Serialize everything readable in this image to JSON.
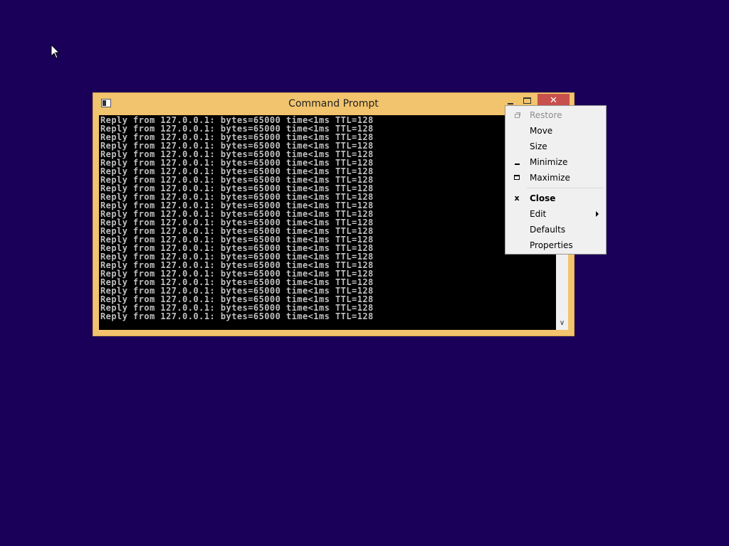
{
  "window": {
    "title": "Command Prompt",
    "close_glyph": "✕"
  },
  "console": {
    "lines": [
      "Reply from 127.0.0.1: bytes=65000 time<1ms TTL=128",
      "Reply from 127.0.0.1: bytes=65000 time<1ms TTL=128",
      "Reply from 127.0.0.1: bytes=65000 time<1ms TTL=128",
      "Reply from 127.0.0.1: bytes=65000 time<1ms TTL=128",
      "Reply from 127.0.0.1: bytes=65000 time<1ms TTL=128",
      "Reply from 127.0.0.1: bytes=65000 time<1ms TTL=128",
      "Reply from 127.0.0.1: bytes=65000 time<1ms TTL=128",
      "Reply from 127.0.0.1: bytes=65000 time<1ms TTL=128",
      "Reply from 127.0.0.1: bytes=65000 time<1ms TTL=128",
      "Reply from 127.0.0.1: bytes=65000 time<1ms TTL=128",
      "Reply from 127.0.0.1: bytes=65000 time<1ms TTL=128",
      "Reply from 127.0.0.1: bytes=65000 time<1ms TTL=128",
      "Reply from 127.0.0.1: bytes=65000 time<1ms TTL=128",
      "Reply from 127.0.0.1: bytes=65000 time<1ms TTL=128",
      "Reply from 127.0.0.1: bytes=65000 time<1ms TTL=128",
      "Reply from 127.0.0.1: bytes=65000 time<1ms TTL=128",
      "Reply from 127.0.0.1: bytes=65000 time<1ms TTL=128",
      "Reply from 127.0.0.1: bytes=65000 time<1ms TTL=128",
      "Reply from 127.0.0.1: bytes=65000 time<1ms TTL=128",
      "Reply from 127.0.0.1: bytes=65000 time<1ms TTL=128",
      "Reply from 127.0.0.1: bytes=65000 time<1ms TTL=128",
      "Reply from 127.0.0.1: bytes=65000 time<1ms TTL=128",
      "Reply from 127.0.0.1: bytes=65000 time<1ms TTL=128",
      "Reply from 127.0.0.1: bytes=65000 time<1ms TTL=128"
    ]
  },
  "system_menu": {
    "items": [
      {
        "label": "Restore",
        "icon": "restore-icon",
        "disabled": true
      },
      {
        "label": "Move",
        "icon": "",
        "disabled": false
      },
      {
        "label": "Size",
        "icon": "",
        "disabled": false
      },
      {
        "label": "Minimize",
        "icon": "minimize-icon",
        "disabled": false
      },
      {
        "label": "Maximize",
        "icon": "maximize-icon",
        "disabled": false
      },
      {
        "label": "Close",
        "icon": "close-icon",
        "disabled": false,
        "bold": true,
        "glyph": "x"
      },
      {
        "label": "Edit",
        "icon": "",
        "disabled": false,
        "submenu": true
      },
      {
        "label": "Defaults",
        "icon": "",
        "disabled": false
      },
      {
        "label": "Properties",
        "icon": "",
        "disabled": false
      }
    ]
  },
  "colors": {
    "desktop": "#1a0059",
    "window_frame": "#f2c46d",
    "close_button": "#c7504d",
    "console_bg": "#000000",
    "console_text": "#c0c0c0"
  }
}
